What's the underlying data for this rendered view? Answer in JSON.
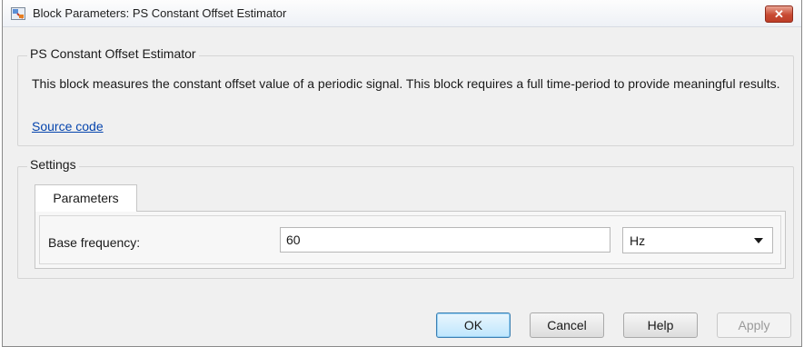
{
  "window": {
    "title": "Block Parameters: PS Constant Offset Estimator",
    "close_label": "✕"
  },
  "block_group": {
    "legend": "PS Constant Offset Estimator",
    "description": "This block measures the constant offset value of a periodic signal. This block requires a full time-period to provide meaningful results.",
    "source_link": "Source code"
  },
  "settings": {
    "legend": "Settings",
    "tabs": [
      {
        "label": "Parameters",
        "active": true
      }
    ],
    "params": [
      {
        "label": "Base frequency:",
        "value": "60",
        "unit": "Hz"
      }
    ]
  },
  "footer": {
    "ok_label": "OK",
    "cancel_label": "Cancel",
    "help_label": "Help",
    "apply_label": "Apply"
  },
  "colors": {
    "link": "#0645ad",
    "close_button": "#c84a33",
    "default_button_border": "#3c7fb1"
  }
}
